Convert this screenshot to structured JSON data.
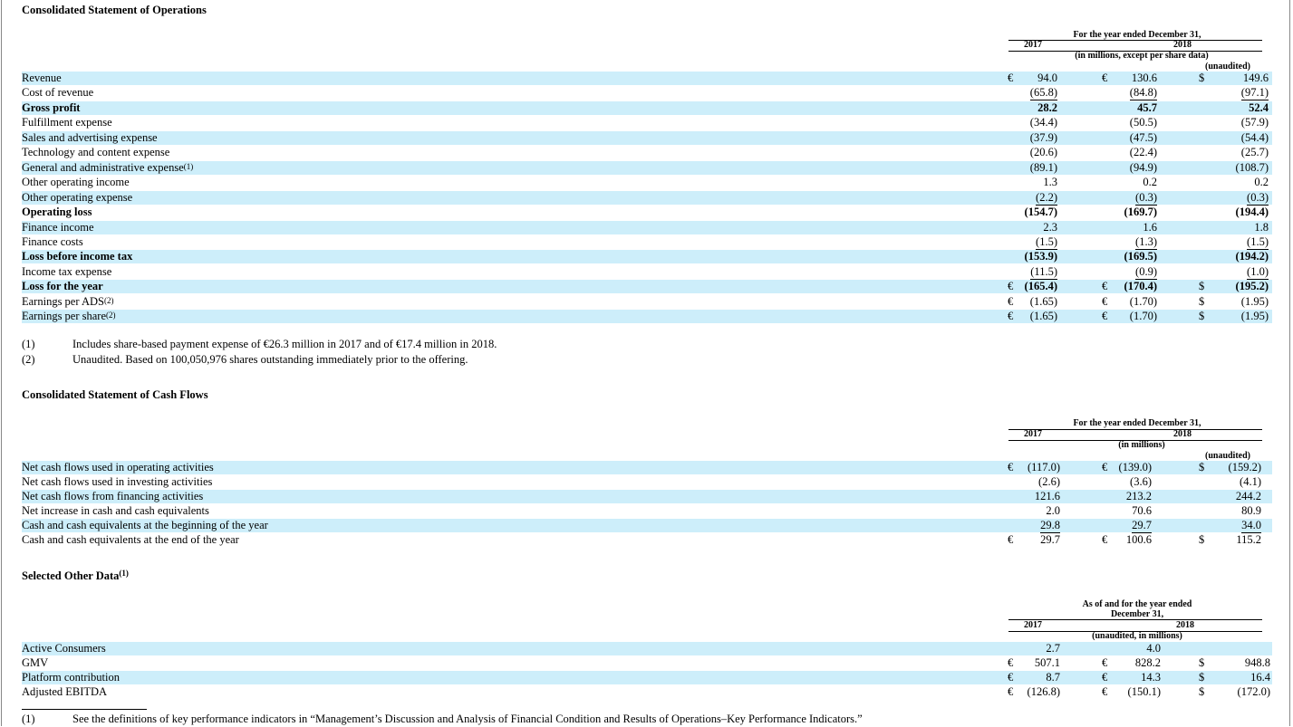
{
  "ops": {
    "title": "Consolidated Statement of Operations",
    "header": {
      "period": "For the year ended December 31,",
      "year1": "2017",
      "year2": "2018",
      "units": "(in millions, except per share data)",
      "unaudited": "(unaudited)"
    },
    "rows": [
      {
        "label": "Revenue",
        "c1": "€",
        "v1": "94.0",
        "c2": "€",
        "v2": "130.6",
        "c3": "$",
        "v3": "149.6"
      },
      {
        "label": "Cost of revenue",
        "v1": "(65.8)",
        "v2": "(84.8)",
        "v3": "(97.1)"
      },
      {
        "label": "Gross profit",
        "v1": "28.2",
        "v2": "45.7",
        "v3": "52.4"
      },
      {
        "label": "Fulfillment expense",
        "v1": "(34.4)",
        "v2": "(50.5)",
        "v3": "(57.9)"
      },
      {
        "label": "Sales and advertising expense",
        "v1": "(37.9)",
        "v2": "(47.5)",
        "v3": "(54.4)"
      },
      {
        "label": "Technology and content expense",
        "v1": "(20.6)",
        "v2": "(22.4)",
        "v3": "(25.7)"
      },
      {
        "label": "General and administrative expense",
        "sup": "(1)",
        "v1": "(89.1)",
        "v2": "(94.9)",
        "v3": "(108.7)"
      },
      {
        "label": "Other operating income",
        "v1": "1.3",
        "v2": "0.2",
        "v3": "0.2"
      },
      {
        "label": "Other operating expense",
        "v1": "(2.2)",
        "v2": "(0.3)",
        "v3": "(0.3)"
      },
      {
        "label": "Operating loss",
        "v1": "(154.7)",
        "v2": "(169.7)",
        "v3": "(194.4)"
      },
      {
        "label": "Finance income",
        "v1": "2.3",
        "v2": "1.6",
        "v3": "1.8"
      },
      {
        "label": "Finance costs",
        "v1": "(1.5)",
        "v2": "(1.3)",
        "v3": "(1.5)"
      },
      {
        "label": "Loss before income tax",
        "v1": "(153.9)",
        "v2": "(169.5)",
        "v3": "(194.2)"
      },
      {
        "label": "Income tax expense",
        "v1": "(11.5)",
        "v2": "(0.9)",
        "v3": "(1.0)"
      },
      {
        "label": "Loss for the year",
        "c1": "€",
        "v1": "(165.4)",
        "c2": "€",
        "v2": "(170.4)",
        "c3": "$",
        "v3": "(195.2)"
      },
      {
        "label": "Earnings per ADS",
        "sup": "(2)",
        "c1": "€",
        "v1": "(1.65)",
        "c2": "€",
        "v2": "(1.70)",
        "c3": "$",
        "v3": "(1.95)"
      },
      {
        "label": "Earnings per share",
        "sup": "(2)",
        "c1": "€",
        "v1": "(1.65)",
        "c2": "€",
        "v2": "(1.70)",
        "c3": "$",
        "v3": "(1.95)"
      }
    ],
    "footnotes": [
      {
        "num": "(1)",
        "text": "Includes share-based payment expense of €26.3 million in 2017 and of €17.4 million in 2018."
      },
      {
        "num": "(2)",
        "text": "Unaudited. Based on 100,050,976 shares outstanding immediately prior to the offering."
      }
    ]
  },
  "cash": {
    "title": "Consolidated Statement of Cash Flows",
    "header": {
      "period": "For the year ended December 31,",
      "year1": "2017",
      "year2": "2018",
      "units": "(in millions)",
      "unaudited": "(unaudited)"
    },
    "rows": [
      {
        "label": "Net cash flows used in operating activities",
        "c1": "€",
        "v1": "(117.0)",
        "c2": "€",
        "v2": "(139.0)",
        "c3": "$",
        "v3": "(159.2)"
      },
      {
        "label": "Net cash flows used in investing activities",
        "v1": "(2.6)",
        "v2": "(3.6)",
        "v3": "(4.1)"
      },
      {
        "label": "Net cash flows from financing activities",
        "v1": "121.6",
        "v2": "213.2",
        "v3": "244.2"
      },
      {
        "label": "Net increase in cash and cash equivalents",
        "v1": "2.0",
        "v2": "70.6",
        "v3": "80.9"
      },
      {
        "label": "Cash and cash equivalents at the beginning of the year",
        "v1": "29.8",
        "v2": "29.7",
        "v3": "34.0"
      },
      {
        "label": "Cash and cash equivalents at the end of the year",
        "c1": "€",
        "v1": "29.7",
        "c2": "€",
        "v2": "100.6",
        "c3": "$",
        "v3": "115.2"
      }
    ]
  },
  "other": {
    "title": "Selected Other Data",
    "title_sup": "(1)",
    "header": {
      "period_line1": "As of and for the year ended",
      "period_line2": "December 31,",
      "year1": "2017",
      "year2": "2018",
      "units": "(unaudited, in millions)"
    },
    "rows": [
      {
        "label": "Active Consumers",
        "v1": "2.7",
        "v2": "4.0"
      },
      {
        "label": "GMV",
        "c1": "€",
        "v1": "507.1",
        "c2": "€",
        "v2": "828.2",
        "c3": "$",
        "v3": "948.8"
      },
      {
        "label": "Platform contribution",
        "c1": "€",
        "v1": "8.7",
        "c2": "€",
        "v2": "14.3",
        "c3": "$",
        "v3": "16.4"
      },
      {
        "label": "Adjusted EBITDA",
        "c1": "€",
        "v1": "(126.8)",
        "c2": "€",
        "v2": "(150.1)",
        "c3": "$",
        "v3": "(172.0)"
      }
    ],
    "footnote": {
      "num": "(1)",
      "text": "See the definitions of key performance indicators in “Management’s Discussion and Analysis of Financial Condition and Results of Operations–Key Performance Indicators.”"
    }
  }
}
